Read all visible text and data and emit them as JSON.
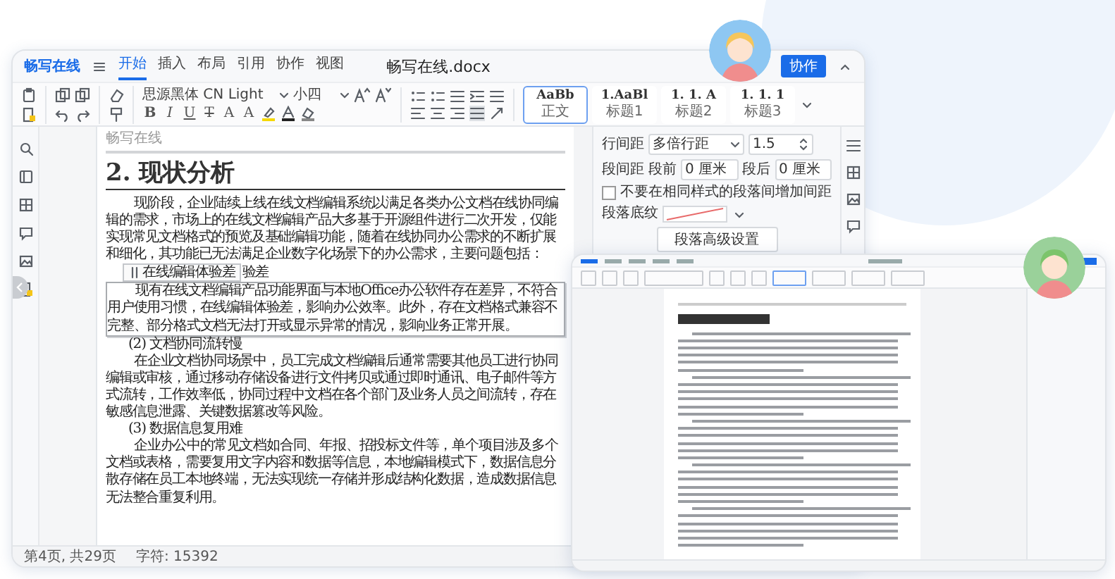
{
  "editor": {
    "logo": "畅写在线",
    "tabs": [
      {
        "label": "开始",
        "selected": true
      },
      {
        "label": "插入",
        "selected": false
      },
      {
        "label": "布局",
        "selected": false
      },
      {
        "label": "引用",
        "selected": false
      },
      {
        "label": "协作",
        "selected": false
      },
      {
        "label": "视图",
        "selected": false
      }
    ],
    "document_title": "畅写在线.docx",
    "collab_button": "协作",
    "toolbar": {
      "font": "思源黑体 CN Light",
      "size": "小四",
      "format_buttons": [
        "B",
        "I",
        "U",
        "T",
        "A",
        "A"
      ]
    },
    "styles": [
      {
        "preview": "AaBb",
        "name": "正文",
        "selected": true
      },
      {
        "preview": "1.AaBl",
        "name": "标题1",
        "selected": false
      },
      {
        "preview": "1. 1. A",
        "name": "标题2",
        "selected": false
      },
      {
        "preview": "1. 1. 1",
        "name": "标题3",
        "selected": false
      }
    ],
    "document": {
      "header": "畅写在线",
      "heading": "2. 现状分析",
      "blocks": [
        {
          "kind": "paragraph",
          "text": "现阶段，企业陆续上线在线文档编辑系统以满足各类办公文档在线协同编辑的需求，市场上的在线文档编辑产品大多基于开源组件进行二次开发，仅能实现常见文档格式的预览及基础编辑功能，随着在线协同办公需求的不断扩展和细化，其功能已无法满足企业数字化场景下的办公需求，主要问题包括："
        },
        {
          "kind": "tagged",
          "tag": "在线编辑体验差",
          "text": "验差"
        },
        {
          "kind": "selected_paragraph",
          "text": "现有在线文档编辑产品功能界面与本地Office办公软件存在差异，不符合用户使用习惯，在线编辑体验差，影响办公效率。此外，存在文档格式兼容不完整、部分格式文档无法打开或显示异常的情况，影响业务正常开展。"
        },
        {
          "kind": "subheading",
          "text": "(2) 文档协同流转慢"
        },
        {
          "kind": "paragraph",
          "text": "在企业文档协同场景中，员工完成文档编辑后通常需要其他员工进行协同编辑或审核，通过移动存储设备进行文件拷贝或通过即时通讯、电子邮件等方式流转，工作效率低，协同过程中文档在各个部门及业务人员之间流转，存在敏感信息泄露、关键数据篡改等风险。"
        },
        {
          "kind": "subheading",
          "text": "(3) 数据信息复用难"
        },
        {
          "kind": "paragraph",
          "text": "企业办公中的常见文档如合同、年报、招投标文件等，单个项目涉及多个文档或表格，需要复用文字内容和数据等信息，本地编辑模式下，数据信息分散存储在员工本地终端，无法实现统一存储并形成结构化数据，造成数据信息无法整合重复利用。"
        }
      ]
    },
    "paragraph_panel": {
      "line_spacing_label": "行间距",
      "line_spacing_mode": "多倍行距",
      "line_spacing_value": "1.5",
      "paragraph_spacing_label": "段间距",
      "before_label": "段前",
      "before_value": "0 厘米",
      "after_label": "段后",
      "after_value": "0 厘米",
      "same_style_option": {
        "label": "不要在相同样式的段落间增加间距",
        "checked": false
      },
      "shading_label": "段落底纹",
      "advanced_button": "段落高级设置"
    },
    "status_bar": {
      "pages": "第4页, 共29页",
      "characters": "字符: 15392"
    }
  }
}
